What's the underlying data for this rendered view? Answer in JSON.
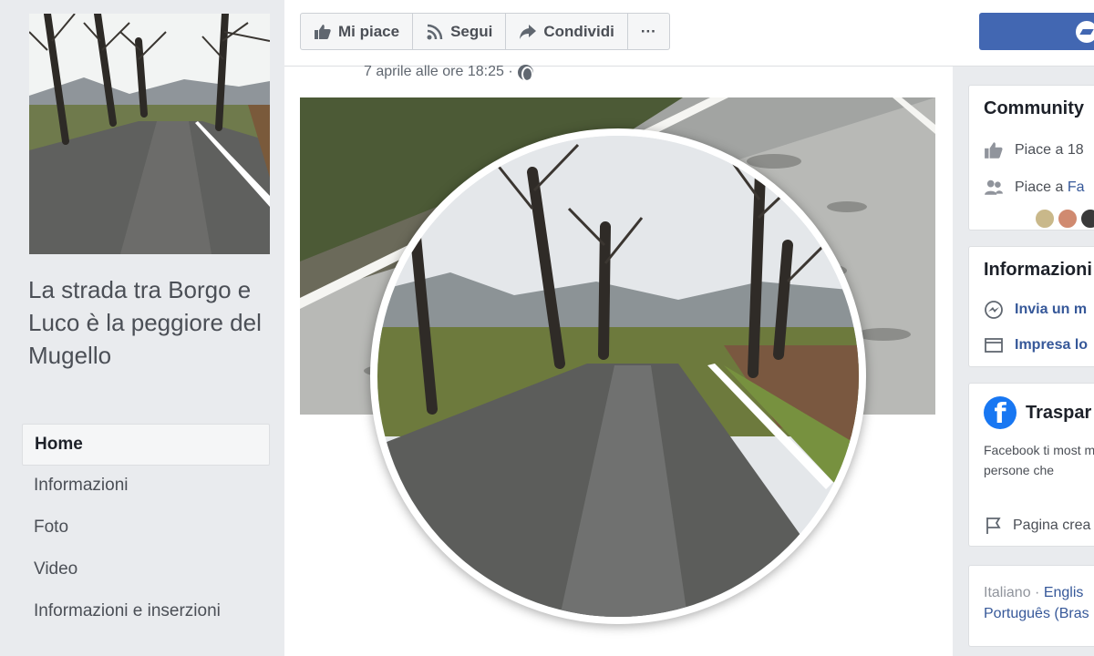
{
  "page": {
    "name": "La strada tra Borgo e Luco è la peggiore del Mugello"
  },
  "nav": {
    "items": [
      {
        "label": "Home",
        "active": true
      },
      {
        "label": "Informazioni",
        "active": false
      },
      {
        "label": "Foto",
        "active": false
      },
      {
        "label": "Video",
        "active": false
      },
      {
        "label": "Informazioni e inserzioni",
        "active": false
      }
    ]
  },
  "actions": {
    "like": "Mi piace",
    "follow": "Segui",
    "share": "Condividi",
    "more": "···"
  },
  "post": {
    "timestamp": "7 aprile alle ore 18:25 ·",
    "privacy_icon": "globe-icon"
  },
  "sidebar": {
    "community": {
      "title": "Community",
      "likes_text": "Piace a 18",
      "friends_prefix": "Piace a",
      "friends_link": "Fa"
    },
    "info": {
      "title": "Informazioni",
      "message_link": "Invia un m",
      "business_link": "Impresa lo"
    },
    "transparency": {
      "title": "Traspar",
      "description": "Facebook ti most meglio lo scopo c dalle persone che",
      "page_created": "Pagina crea"
    },
    "languages": {
      "current": "Italiano ·",
      "link1": "Englis",
      "link2": "Português (Bras"
    }
  },
  "colors": {
    "brand": "#4267b2",
    "link": "#365899",
    "background": "#e9ebee"
  }
}
